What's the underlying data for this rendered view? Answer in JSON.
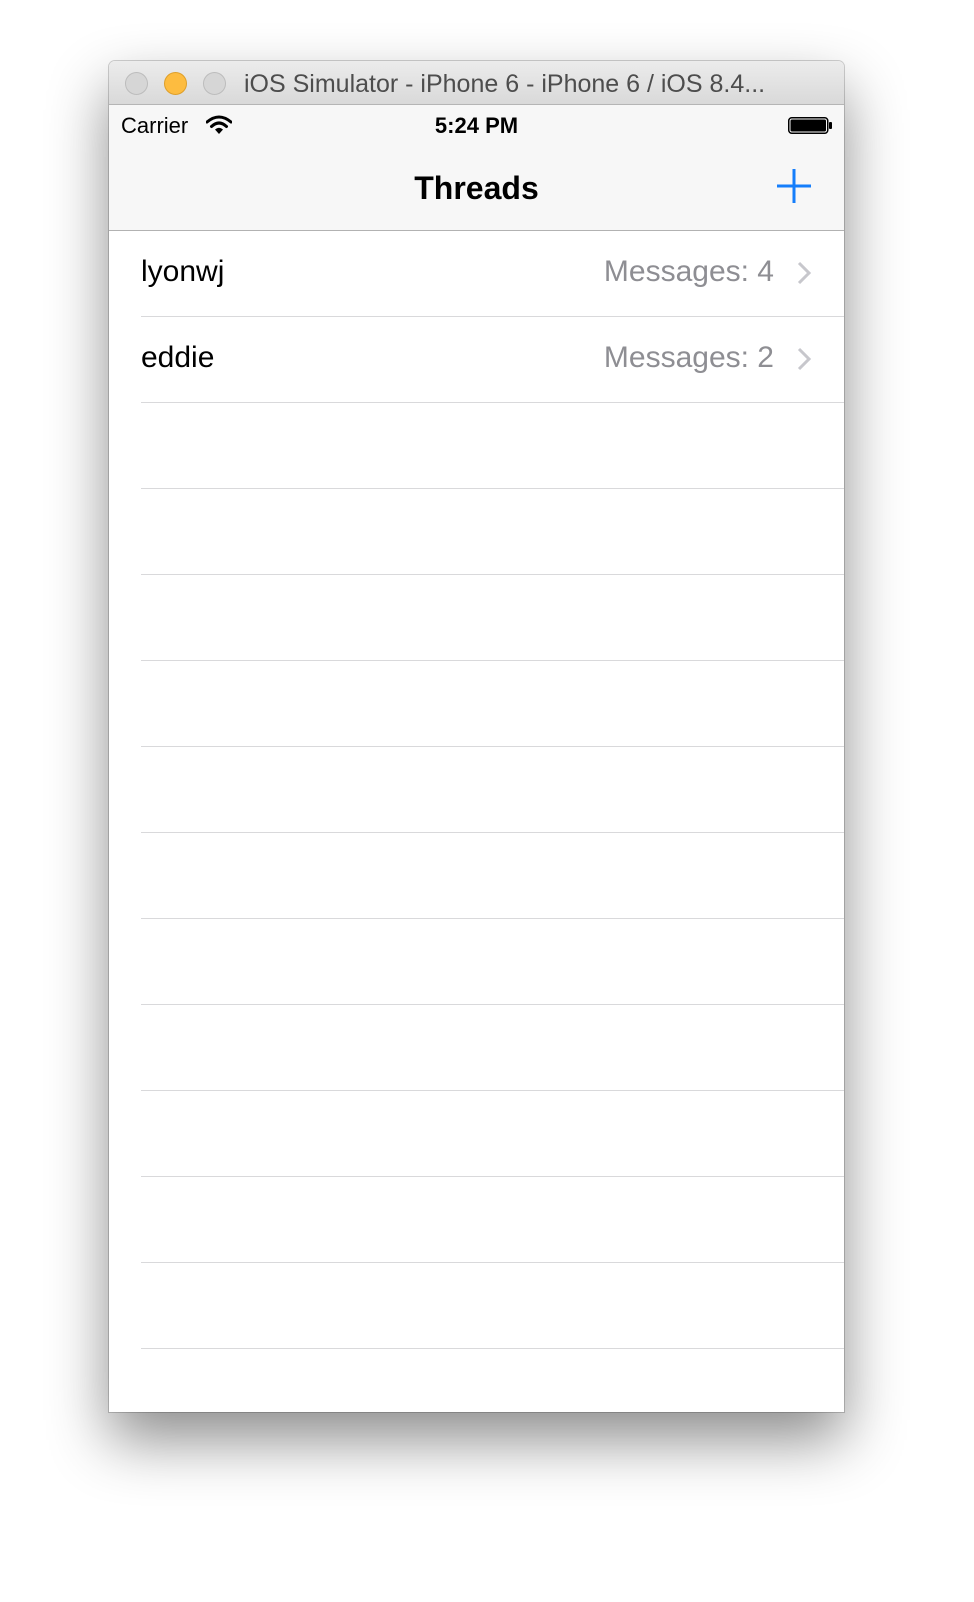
{
  "window": {
    "title": "iOS Simulator - iPhone 6 - iPhone 6 / iOS 8.4..."
  },
  "status_bar": {
    "carrier": "Carrier",
    "time": "5:24 PM"
  },
  "nav_bar": {
    "title": "Threads",
    "add_icon": "plus-icon"
  },
  "threads": [
    {
      "name": "lyonwj",
      "detail": "Messages: 4"
    },
    {
      "name": "eddie",
      "detail": "Messages: 2"
    }
  ],
  "colors": {
    "accent": "#157efb",
    "detail_text": "#8e8e93",
    "separator": "#d9d9db"
  }
}
